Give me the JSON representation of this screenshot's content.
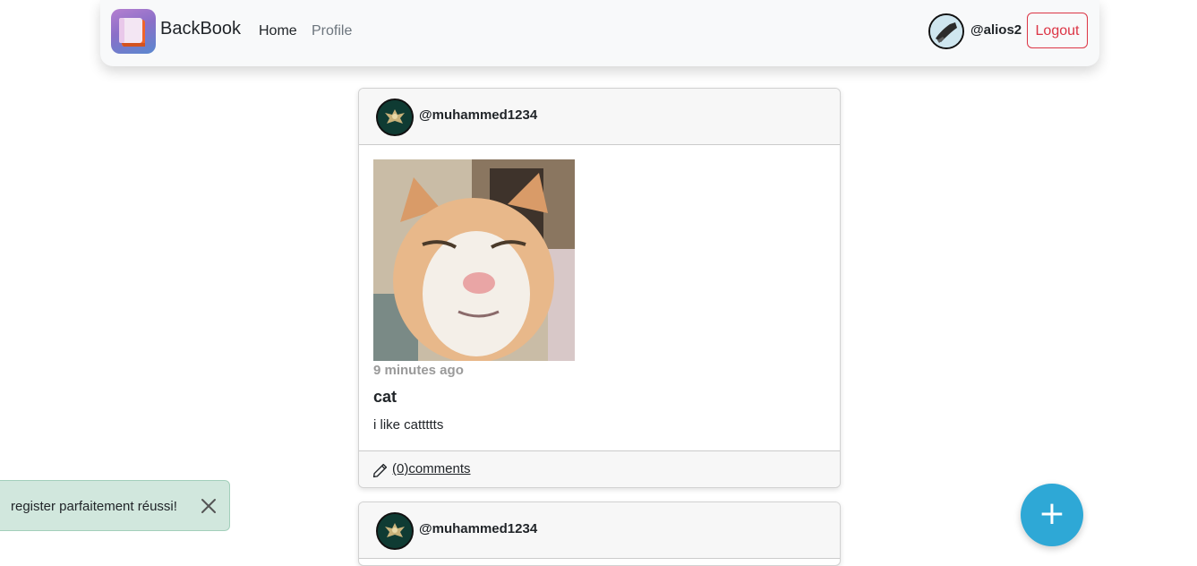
{
  "navbar": {
    "brand": "BackBook",
    "links": [
      {
        "label": "Home"
      },
      {
        "label": "Profile"
      }
    ],
    "user": {
      "username": "@alios2"
    },
    "logout_label": "Logout"
  },
  "posts": [
    {
      "author": "@muhammed1234",
      "time": "9 minutes ago",
      "title": "cat",
      "body": "i like cattttts",
      "comments_count": "(0)",
      "comments_label": "comments"
    },
    {
      "author": "@muhammed1234"
    }
  ],
  "toast": {
    "message": "register parfaitement réussi!"
  },
  "fab": {
    "icon": "plus-icon",
    "symbol": "+"
  },
  "icons": {
    "brand": "book-logo-icon",
    "edit": "pencil-icon",
    "close": "close-icon"
  },
  "colors": {
    "navbar_bg": "#f8f9fa",
    "logout": "#dc3545",
    "toast_bg": "#d1e7dd",
    "fab": "#2ea8d6"
  }
}
